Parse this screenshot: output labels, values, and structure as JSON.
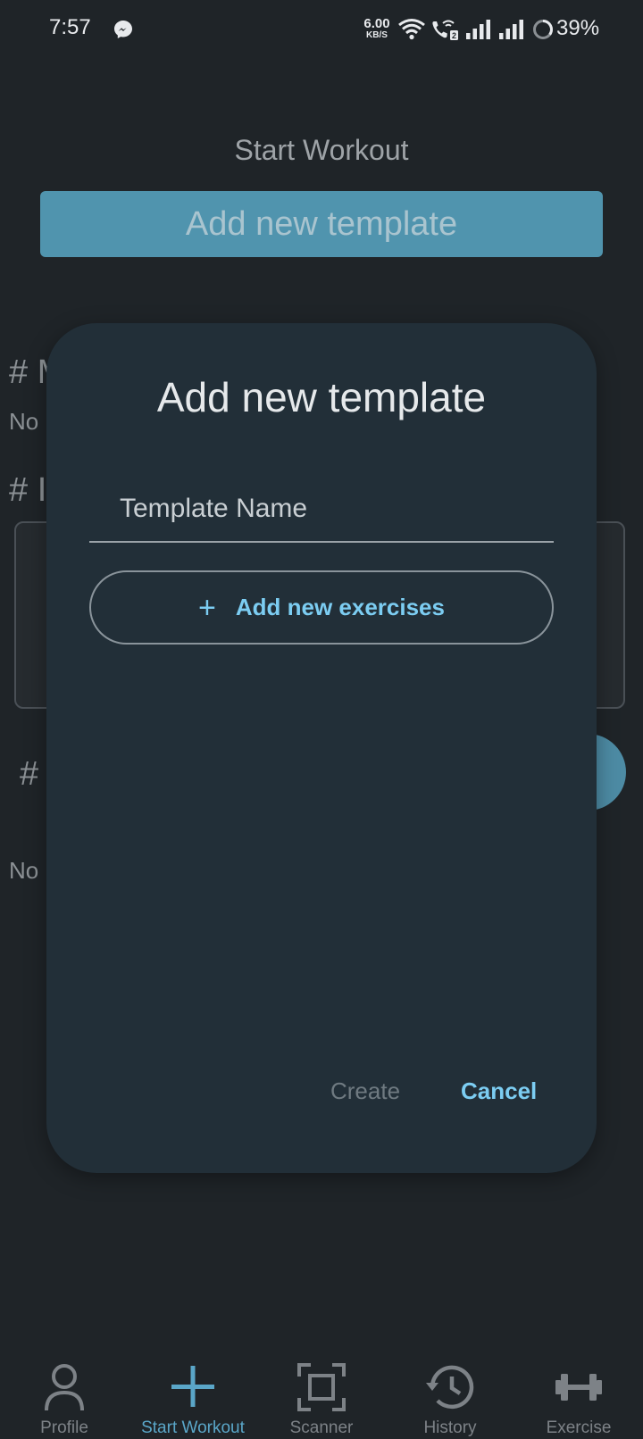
{
  "status_bar": {
    "time": "7:57",
    "net_speed_value": "6.00",
    "net_speed_unit": "KB/S",
    "battery_percent": "39%"
  },
  "page": {
    "title": "Start Workout",
    "add_template_label": "Add new template",
    "section_heading_1": "# M",
    "no_text_1": "No",
    "section_heading_2": "# I",
    "section_heading_3": "#",
    "no_text_2": "No"
  },
  "dialog": {
    "title": "Add new template",
    "name_placeholder": "Template Name",
    "add_exercises_label": "Add new exercises",
    "add_exercises_icon": "plus-icon",
    "create_label": "Create",
    "cancel_label": "Cancel"
  },
  "bottom_nav": {
    "items": [
      {
        "label": "Profile",
        "icon": "person-icon"
      },
      {
        "label": "Start Workout",
        "icon": "plus-icon",
        "active": true
      },
      {
        "label": "Scanner",
        "icon": "scan-icon"
      },
      {
        "label": "History",
        "icon": "history-icon"
      },
      {
        "label": "Exercise",
        "icon": "dumbbell-icon"
      }
    ]
  },
  "colors": {
    "background": "#1f2428",
    "dialog": "#222f38",
    "accent": "#7ccdf2",
    "primary_button": "#5094ae"
  }
}
